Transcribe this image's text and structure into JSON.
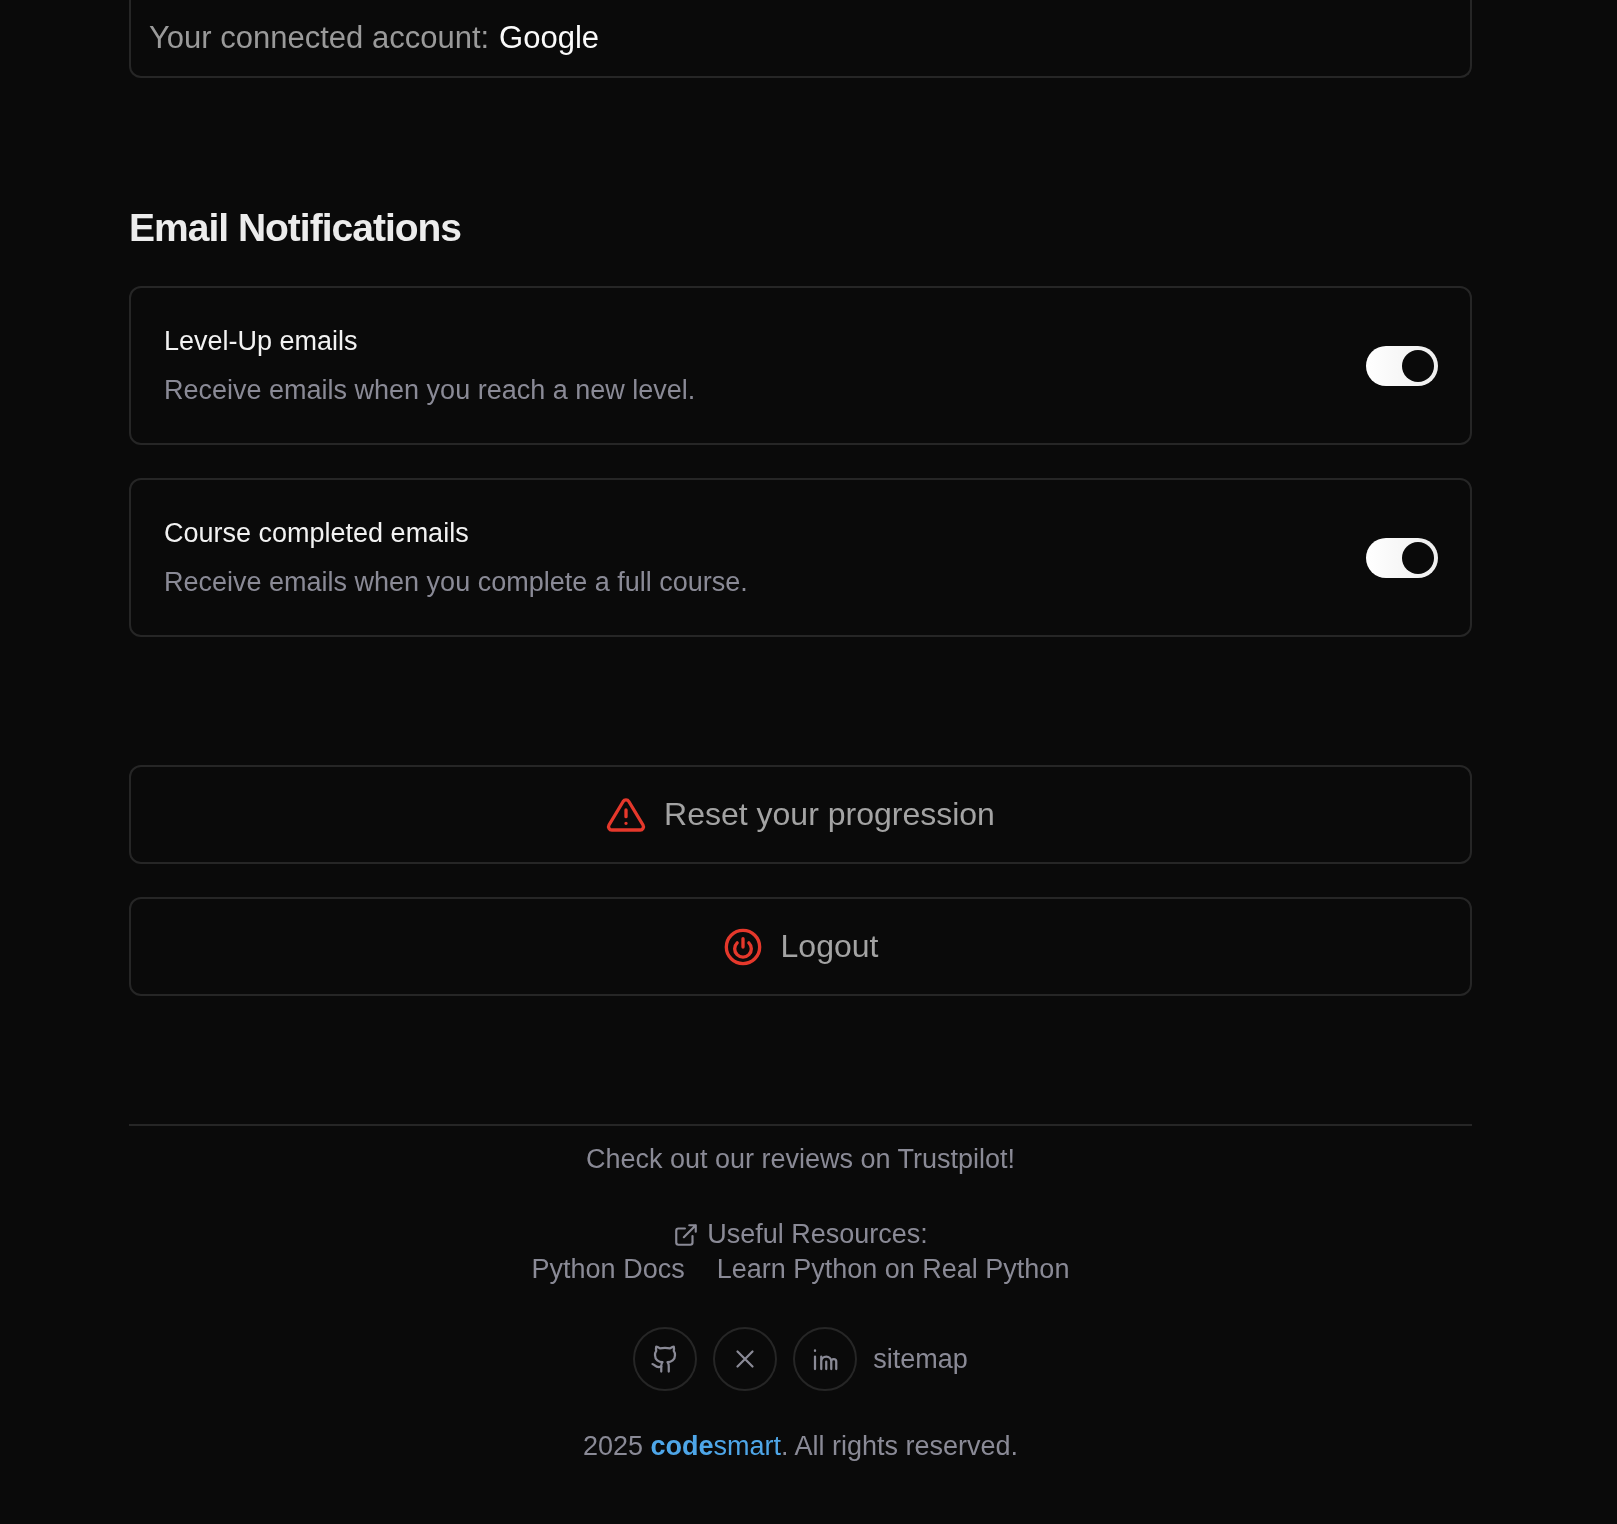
{
  "connected_account": {
    "label": "Your connected account:",
    "value": "Google"
  },
  "email_notifications": {
    "title": "Email Notifications",
    "items": [
      {
        "title": "Level-Up emails",
        "description": "Receive emails when you reach a new level.",
        "on": true
      },
      {
        "title": "Course completed emails",
        "description": "Receive emails when you complete a full course.",
        "on": true
      }
    ]
  },
  "actions": [
    {
      "kind": "warning",
      "label": "Reset your progression"
    },
    {
      "kind": "power",
      "label": "Logout"
    }
  ],
  "footer": {
    "trustpilot": "Check out our reviews on Trustpilot!",
    "resources_title": "Useful Resources:",
    "resources": [
      "Python Docs",
      "Learn Python on Real Python"
    ],
    "social": [
      {
        "kind": "github"
      },
      {
        "kind": "x"
      },
      {
        "kind": "linkedin"
      }
    ],
    "sitemap": "sitemap",
    "copyright_prefix": "2025",
    "brand": "**code**smart",
    "copyright_suffix": ". All rights reserved."
  }
}
